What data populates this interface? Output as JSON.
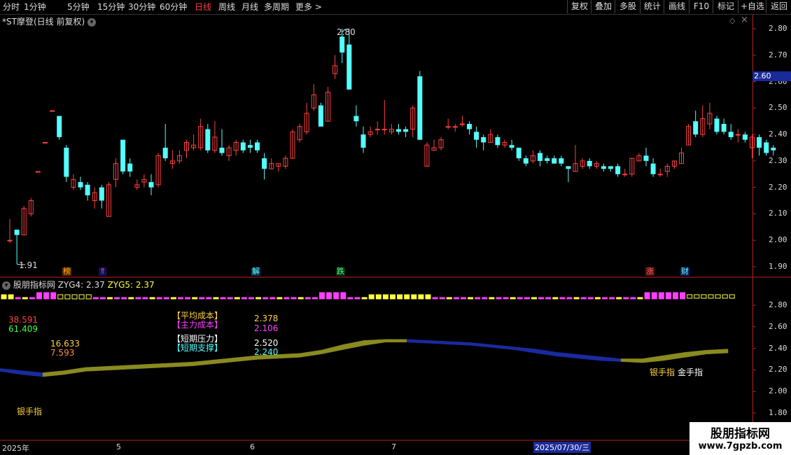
{
  "toolbar": {
    "periods": [
      "分时",
      "1分钟",
      "5分钟",
      "15分钟",
      "30分钟",
      "60分钟",
      "日线",
      "周线",
      "月线",
      "多周期",
      "更多 >"
    ],
    "active_period": "日线",
    "buttons": [
      "复权",
      "叠加",
      "多股",
      "统计",
      "画线",
      "F10",
      "标记",
      "+自选",
      "返回"
    ]
  },
  "main_chart": {
    "title": "*ST摩登(日线 前复权)",
    "high_label": "2.80",
    "low_label": "1.91",
    "current_price": "2.60",
    "y_ticks": [
      "2.80",
      "2.70",
      "2.60",
      "2.50",
      "2.40",
      "2.30",
      "2.20",
      "2.10",
      "2.00",
      "1.90"
    ],
    "markers": [
      {
        "text": "榜",
        "color": "#ffb000",
        "bg": "#5a2a00"
      },
      {
        "text": "⇑",
        "color": "#ff5050",
        "bg": "#101060"
      },
      {
        "text": "解",
        "color": "#66ffff",
        "bg": "#003050"
      },
      {
        "text": "跌",
        "color": "#66ff66",
        "bg": "#003020"
      },
      {
        "text": "涨",
        "color": "#ff6060",
        "bg": "#501010"
      },
      {
        "text": "财",
        "color": "#66ffff",
        "bg": "#102060"
      }
    ]
  },
  "indicator": {
    "name": "股朋指标网",
    "zyg4_label": "ZYG4: 2.37",
    "zyg5_label": "ZYG5: 2.37",
    "left_val1": "38.591",
    "left_val2": "61.409",
    "left_val3": "16.633",
    "left_val4": "7.593",
    "avg_cost_label": "【平均成本】",
    "avg_cost_value": "2.378",
    "main_cost_label": "【主力成本】",
    "main_cost_value": "2.106",
    "short_pressure_label": "【短期压力】",
    "short_pressure_value": "2.520",
    "short_support_label": "【短期支撑】",
    "short_support_value": "2.240",
    "silver_hand_1": "银手指",
    "silver_hand_2": "银手指",
    "gold_hand": "金手指",
    "y_ticks": [
      "2.80",
      "2.60",
      "2.40",
      "2.20",
      "2.00",
      "1.80"
    ]
  },
  "date_axis": {
    "year": "2025年",
    "months": [
      "5",
      "6",
      "7"
    ],
    "cursor_date": "2025/07/30/三"
  },
  "watermark": {
    "line1": "股朋指标网",
    "line2": "www.7gpzb.com"
  },
  "colors": {
    "up": "#ff4040",
    "down": "#54ffff",
    "zyg_magenta": "#ff40ff",
    "zyg_yellow": "#ffff40",
    "band_gold": "#8a8a20",
    "band_blue": "#1a2aa0"
  },
  "chart_data": {
    "type": "candlestick",
    "ylim": [
      1.87,
      2.84
    ],
    "candles": [
      {
        "o": 2.0,
        "c": 2.0,
        "h": 2.08,
        "l": 1.99
      },
      {
        "o": 2.04,
        "c": 2.02,
        "h": 2.04,
        "l": 1.91
      },
      {
        "o": 2.02,
        "c": 2.12,
        "h": 2.13,
        "l": 2.02
      },
      {
        "o": 2.1,
        "c": 2.15,
        "h": 2.16,
        "l": 2.09
      },
      {
        "o": 2.26,
        "c": 2.26,
        "h": 2.26,
        "l": 2.26
      },
      {
        "o": 2.37,
        "c": 2.37,
        "h": 2.37,
        "l": 2.37
      },
      {
        "o": 2.49,
        "c": 2.49,
        "h": 2.49,
        "l": 2.49
      },
      {
        "o": 2.47,
        "c": 2.39,
        "h": 2.47,
        "l": 2.38
      },
      {
        "o": 2.35,
        "c": 2.24,
        "h": 2.36,
        "l": 2.22
      },
      {
        "o": 2.2,
        "c": 2.23,
        "h": 2.25,
        "l": 2.19
      },
      {
        "o": 2.22,
        "c": 2.2,
        "h": 2.24,
        "l": 2.19
      },
      {
        "o": 2.21,
        "c": 2.17,
        "h": 2.22,
        "l": 2.15
      },
      {
        "o": 2.15,
        "c": 2.18,
        "h": 2.2,
        "l": 2.12
      },
      {
        "o": 2.2,
        "c": 2.15,
        "h": 2.21,
        "l": 2.12
      },
      {
        "o": 2.09,
        "c": 2.21,
        "h": 2.22,
        "l": 2.09
      },
      {
        "o": 2.23,
        "c": 2.29,
        "h": 2.31,
        "l": 2.2
      },
      {
        "o": 2.38,
        "c": 2.26,
        "h": 2.38,
        "l": 2.25
      },
      {
        "o": 2.29,
        "c": 2.26,
        "h": 2.31,
        "l": 2.24
      },
      {
        "o": 2.2,
        "c": 2.21,
        "h": 2.23,
        "l": 2.19
      },
      {
        "o": 2.22,
        "c": 2.23,
        "h": 2.25,
        "l": 2.2
      },
      {
        "o": 2.22,
        "c": 2.2,
        "h": 2.25,
        "l": 2.17
      },
      {
        "o": 2.21,
        "c": 2.32,
        "h": 2.33,
        "l": 2.2
      },
      {
        "o": 2.35,
        "c": 2.31,
        "h": 2.44,
        "l": 2.3
      },
      {
        "o": 2.29,
        "c": 2.3,
        "h": 2.34,
        "l": 2.27
      },
      {
        "o": 2.3,
        "c": 2.32,
        "h": 2.34,
        "l": 2.29
      },
      {
        "o": 2.34,
        "c": 2.37,
        "h": 2.38,
        "l": 2.31
      },
      {
        "o": 2.35,
        "c": 2.36,
        "h": 2.4,
        "l": 2.34
      },
      {
        "o": 2.35,
        "c": 2.43,
        "h": 2.46,
        "l": 2.34
      },
      {
        "o": 2.42,
        "c": 2.34,
        "h": 2.44,
        "l": 2.33
      },
      {
        "o": 2.34,
        "c": 2.39,
        "h": 2.45,
        "l": 2.33
      },
      {
        "o": 2.35,
        "c": 2.33,
        "h": 2.42,
        "l": 2.32
      },
      {
        "o": 2.32,
        "c": 2.35,
        "h": 2.36,
        "l": 2.3
      },
      {
        "o": 2.34,
        "c": 2.37,
        "h": 2.38,
        "l": 2.32
      },
      {
        "o": 2.37,
        "c": 2.34,
        "h": 2.38,
        "l": 2.33
      },
      {
        "o": 2.36,
        "c": 2.35,
        "h": 2.38,
        "l": 2.33
      },
      {
        "o": 2.37,
        "c": 2.34,
        "h": 2.38,
        "l": 2.33
      },
      {
        "o": 2.31,
        "c": 2.27,
        "h": 2.33,
        "l": 2.23
      },
      {
        "o": 2.27,
        "c": 2.29,
        "h": 2.31,
        "l": 2.27
      },
      {
        "o": 2.28,
        "c": 2.29,
        "h": 2.29,
        "l": 2.26
      },
      {
        "o": 2.28,
        "c": 2.31,
        "h": 2.32,
        "l": 2.27
      },
      {
        "o": 2.31,
        "c": 2.41,
        "h": 2.42,
        "l": 2.31
      },
      {
        "o": 2.38,
        "c": 2.43,
        "h": 2.44,
        "l": 2.37
      },
      {
        "o": 2.41,
        "c": 2.48,
        "h": 2.52,
        "l": 2.4
      },
      {
        "o": 2.5,
        "c": 2.55,
        "h": 2.59,
        "l": 2.49
      },
      {
        "o": 2.51,
        "c": 2.43,
        "h": 2.52,
        "l": 2.43
      },
      {
        "o": 2.45,
        "c": 2.56,
        "h": 2.58,
        "l": 2.45
      },
      {
        "o": 2.63,
        "c": 2.66,
        "h": 2.7,
        "l": 2.61
      },
      {
        "o": 2.77,
        "c": 2.71,
        "h": 2.8,
        "l": 2.67
      },
      {
        "o": 2.74,
        "c": 2.57,
        "h": 2.8,
        "l": 2.57
      },
      {
        "o": 2.47,
        "c": 2.45,
        "h": 2.51,
        "l": 2.43
      },
      {
        "o": 2.4,
        "c": 2.35,
        "h": 2.43,
        "l": 2.33
      },
      {
        "o": 2.4,
        "c": 2.41,
        "h": 2.43,
        "l": 2.39
      },
      {
        "o": 2.42,
        "c": 2.42,
        "h": 2.45,
        "l": 2.4
      },
      {
        "o": 2.42,
        "c": 2.42,
        "h": 2.53,
        "l": 2.4
      },
      {
        "o": 2.41,
        "c": 2.42,
        "h": 2.44,
        "l": 2.4
      },
      {
        "o": 2.42,
        "c": 2.41,
        "h": 2.44,
        "l": 2.4
      },
      {
        "o": 2.42,
        "c": 2.41,
        "h": 2.43,
        "l": 2.39
      },
      {
        "o": 2.42,
        "c": 2.5,
        "h": 2.51,
        "l": 2.39
      },
      {
        "o": 2.62,
        "c": 2.38,
        "h": 2.64,
        "l": 2.38
      },
      {
        "o": 2.28,
        "c": 2.36,
        "h": 2.37,
        "l": 2.28
      },
      {
        "o": 2.34,
        "c": 2.35,
        "h": 2.38,
        "l": 2.34
      },
      {
        "o": 2.35,
        "c": 2.38,
        "h": 2.39,
        "l": 2.34
      },
      {
        "o": 2.43,
        "c": 2.43,
        "h": 2.46,
        "l": 2.42
      },
      {
        "o": 2.43,
        "c": 2.43,
        "h": 2.44,
        "l": 2.41
      },
      {
        "o": 2.44,
        "c": 2.44,
        "h": 2.47,
        "l": 2.43
      },
      {
        "o": 2.44,
        "c": 2.42,
        "h": 2.45,
        "l": 2.4
      },
      {
        "o": 2.41,
        "c": 2.38,
        "h": 2.43,
        "l": 2.35
      },
      {
        "o": 2.39,
        "c": 2.37,
        "h": 2.4,
        "l": 2.34
      },
      {
        "o": 2.37,
        "c": 2.4,
        "h": 2.42,
        "l": 2.37
      },
      {
        "o": 2.39,
        "c": 2.36,
        "h": 2.4,
        "l": 2.35
      },
      {
        "o": 2.36,
        "c": 2.37,
        "h": 2.38,
        "l": 2.35
      },
      {
        "o": 2.36,
        "c": 2.35,
        "h": 2.38,
        "l": 2.34
      },
      {
        "o": 2.35,
        "c": 2.31,
        "h": 2.35,
        "l": 2.3
      },
      {
        "o": 2.31,
        "c": 2.29,
        "h": 2.32,
        "l": 2.28
      },
      {
        "o": 2.3,
        "c": 2.32,
        "h": 2.34,
        "l": 2.29
      },
      {
        "o": 2.33,
        "c": 2.3,
        "h": 2.34,
        "l": 2.28
      },
      {
        "o": 2.31,
        "c": 2.3,
        "h": 2.32,
        "l": 2.29
      },
      {
        "o": 2.31,
        "c": 2.29,
        "h": 2.32,
        "l": 2.29
      },
      {
        "o": 2.31,
        "c": 2.29,
        "h": 2.32,
        "l": 2.28
      },
      {
        "o": 2.28,
        "c": 2.27,
        "h": 2.28,
        "l": 2.22
      },
      {
        "o": 2.26,
        "c": 2.29,
        "h": 2.36,
        "l": 2.26
      },
      {
        "o": 2.28,
        "c": 2.3,
        "h": 2.31,
        "l": 2.27
      },
      {
        "o": 2.3,
        "c": 2.28,
        "h": 2.31,
        "l": 2.27
      },
      {
        "o": 2.28,
        "c": 2.29,
        "h": 2.3,
        "l": 2.27
      },
      {
        "o": 2.28,
        "c": 2.27,
        "h": 2.29,
        "l": 2.26
      },
      {
        "o": 2.28,
        "c": 2.27,
        "h": 2.28,
        "l": 2.26
      },
      {
        "o": 2.28,
        "c": 2.25,
        "h": 2.29,
        "l": 2.24
      },
      {
        "o": 2.25,
        "c": 2.25,
        "h": 2.27,
        "l": 2.24
      },
      {
        "o": 2.25,
        "c": 2.31,
        "h": 2.31,
        "l": 2.24
      },
      {
        "o": 2.3,
        "c": 2.32,
        "h": 2.33,
        "l": 2.3
      },
      {
        "o": 2.32,
        "c": 2.3,
        "h": 2.35,
        "l": 2.28
      },
      {
        "o": 2.29,
        "c": 2.25,
        "h": 2.31,
        "l": 2.24
      },
      {
        "o": 2.25,
        "c": 2.25,
        "h": 2.27,
        "l": 2.24
      },
      {
        "o": 2.26,
        "c": 2.28,
        "h": 2.29,
        "l": 2.24
      },
      {
        "o": 2.28,
        "c": 2.3,
        "h": 2.3,
        "l": 2.27
      },
      {
        "o": 2.29,
        "c": 2.33,
        "h": 2.35,
        "l": 2.29
      },
      {
        "o": 2.36,
        "c": 2.43,
        "h": 2.44,
        "l": 2.36
      },
      {
        "o": 2.45,
        "c": 2.4,
        "h": 2.49,
        "l": 2.39
      },
      {
        "o": 2.4,
        "c": 2.46,
        "h": 2.51,
        "l": 2.39
      },
      {
        "o": 2.44,
        "c": 2.48,
        "h": 2.52,
        "l": 2.42
      },
      {
        "o": 2.46,
        "c": 2.41,
        "h": 2.47,
        "l": 2.4
      },
      {
        "o": 2.44,
        "c": 2.41,
        "h": 2.46,
        "l": 2.4
      },
      {
        "o": 2.41,
        "c": 2.39,
        "h": 2.44,
        "l": 2.38
      },
      {
        "o": 2.4,
        "c": 2.4,
        "h": 2.42,
        "l": 2.37
      },
      {
        "o": 2.4,
        "c": 2.38,
        "h": 2.41,
        "l": 2.37
      },
      {
        "o": 2.35,
        "c": 2.39,
        "h": 2.4,
        "l": 2.31
      },
      {
        "o": 2.39,
        "c": 2.35,
        "h": 2.4,
        "l": 2.32
      },
      {
        "o": 2.37,
        "c": 2.33,
        "h": 2.38,
        "l": 2.32
      },
      {
        "o": 2.35,
        "c": 2.34,
        "h": 2.36,
        "l": 2.32
      }
    ],
    "indicator_band": {
      "ylim": [
        1.75,
        2.94
      ],
      "line_a": [
        2.2,
        2.18,
        2.16,
        2.18,
        2.21,
        2.22,
        2.23,
        2.24,
        2.25,
        2.26,
        2.28,
        2.3,
        2.32,
        2.33,
        2.34,
        2.37,
        2.42,
        2.46,
        2.47,
        2.47,
        2.46,
        2.45,
        2.44,
        2.42,
        2.4,
        2.38,
        2.35,
        2.33,
        2.31,
        2.29,
        2.29,
        2.32,
        2.35,
        2.37,
        2.38
      ],
      "line_b": [
        2.2,
        2.17,
        2.15,
        2.17,
        2.2,
        2.21,
        2.22,
        2.23,
        2.24,
        2.25,
        2.27,
        2.29,
        2.31,
        2.32,
        2.33,
        2.36,
        2.4,
        2.44,
        2.47,
        2.47,
        2.46,
        2.45,
        2.44,
        2.42,
        2.4,
        2.37,
        2.34,
        2.32,
        2.3,
        2.29,
        2.28,
        2.3,
        2.33,
        2.36,
        2.37
      ]
    }
  }
}
